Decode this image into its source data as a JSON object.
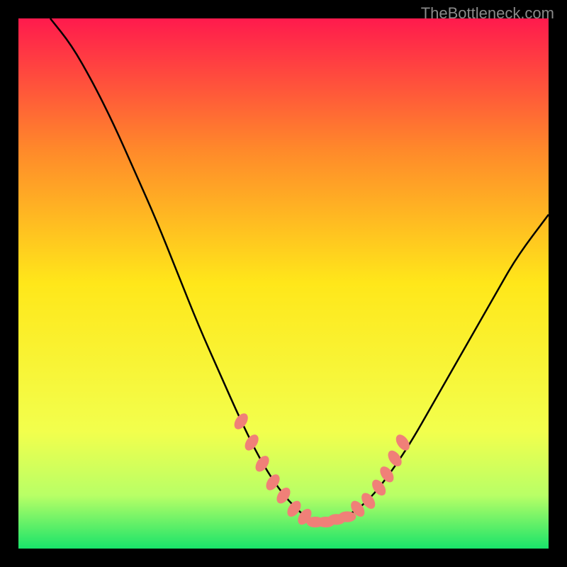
{
  "watermark": "TheBottleneck.com",
  "chart_data": {
    "type": "line",
    "title": "",
    "xlabel": "",
    "ylabel": "",
    "xlim": [
      0,
      100
    ],
    "ylim": [
      0,
      100
    ],
    "background_gradient": {
      "stops": [
        {
          "offset": 0,
          "color": "#ff1a4d"
        },
        {
          "offset": 25,
          "color": "#ff8a2a"
        },
        {
          "offset": 50,
          "color": "#ffe71a"
        },
        {
          "offset": 78,
          "color": "#f2ff4d"
        },
        {
          "offset": 90,
          "color": "#b8ff66"
        },
        {
          "offset": 100,
          "color": "#19e36a"
        }
      ]
    },
    "series": [
      {
        "name": "curve",
        "type": "line",
        "color": "#000000",
        "x": [
          6,
          10,
          14,
          18,
          22,
          26,
          30,
          34,
          38,
          42,
          46,
          50,
          54,
          56,
          58,
          62,
          66,
          70,
          74,
          78,
          82,
          86,
          90,
          94,
          100
        ],
        "y": [
          100,
          95,
          88,
          80,
          71,
          62,
          52,
          42,
          33,
          24,
          16,
          10,
          6,
          5,
          5,
          6,
          9,
          14,
          20,
          27,
          34,
          41,
          48,
          55,
          63
        ]
      },
      {
        "name": "highlight-dots",
        "type": "scatter",
        "color": "#f08078",
        "x": [
          42,
          44,
          46,
          48,
          50,
          52,
          54,
          56,
          58,
          60,
          62,
          64,
          66,
          68,
          69.5,
          71,
          72.5
        ],
        "y": [
          24,
          20,
          16,
          12.5,
          10,
          7.5,
          6,
          5,
          5,
          5.5,
          6,
          7.5,
          9,
          11.5,
          14,
          17,
          20
        ]
      }
    ]
  }
}
